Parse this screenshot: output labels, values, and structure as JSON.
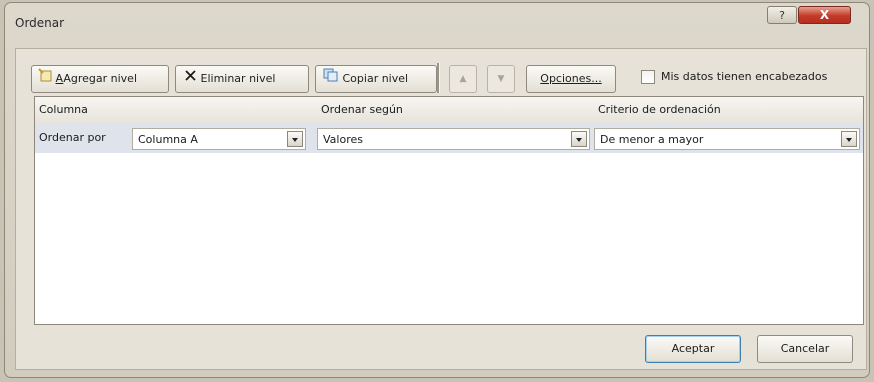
{
  "window": {
    "title": "Ordenar",
    "help_label": "?",
    "close_label": "X"
  },
  "toolbar": {
    "add_level": {
      "label_rest": "Agregar nivel",
      "accel": "A"
    },
    "delete_level": {
      "label": "Eliminar nivel"
    },
    "copy_level": {
      "label": "Copiar nivel"
    },
    "move_up_glyph": "▲",
    "move_down_glyph": "▼",
    "options": {
      "label": "Opciones..."
    },
    "headers_checkbox": {
      "label": "Mis datos tienen encabezados",
      "checked": false
    }
  },
  "grid": {
    "headers": [
      "Columna",
      "Ordenar según",
      "Criterio de ordenación"
    ],
    "levels": [
      {
        "row_label": "Ordenar por",
        "column": "Columna A",
        "sort_on": "Valores",
        "order": "De menor a mayor"
      }
    ]
  },
  "footer": {
    "ok_label": "Aceptar",
    "cancel_label": "Cancelar"
  },
  "colors": {
    "selected_row": "#dfe3ec",
    "close_button": "#c43a28",
    "default_button_border": "#3c7fb1"
  },
  "icons": [
    "add-level-icon",
    "delete-level-icon",
    "copy-level-icon",
    "move-up-icon",
    "move-down-icon",
    "dropdown-arrow-icon"
  ]
}
